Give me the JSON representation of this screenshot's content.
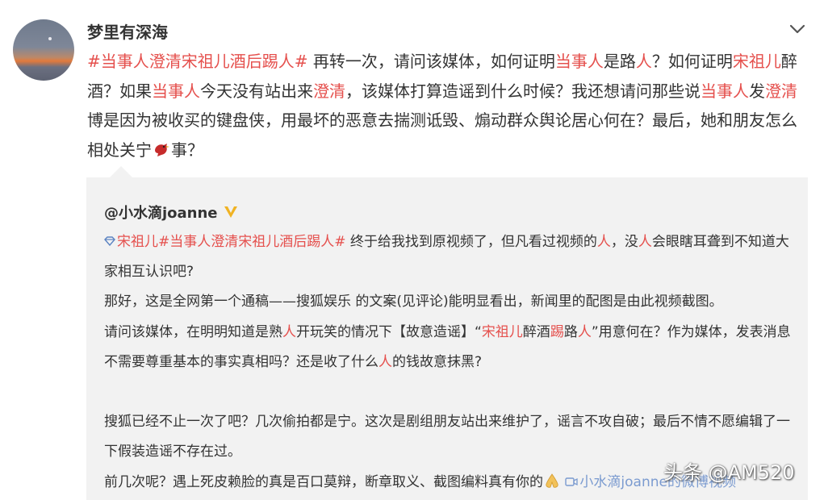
{
  "post": {
    "username": "梦里有深海",
    "segments": [
      {
        "t": "#当事人澄清宋祖儿酒后踢人#",
        "c": "hl"
      },
      {
        "t": " 再转一次，请问该媒体，如何证明",
        "c": ""
      },
      {
        "t": "当事人",
        "c": "hl"
      },
      {
        "t": "是路",
        "c": ""
      },
      {
        "t": "人",
        "c": "hl"
      },
      {
        "t": "？如何证明",
        "c": ""
      },
      {
        "t": "宋祖儿",
        "c": "hl"
      },
      {
        "t": "醉酒？如果",
        "c": ""
      },
      {
        "t": "当事人",
        "c": "hl"
      },
      {
        "t": "今天没有站出来",
        "c": ""
      },
      {
        "t": "澄清",
        "c": "hl"
      },
      {
        "t": "，该媒体打算造谣到什么时候？我还想请问那些说",
        "c": ""
      },
      {
        "t": "当事人",
        "c": "hl"
      },
      {
        "t": "发",
        "c": ""
      },
      {
        "t": "澄清",
        "c": "hl"
      },
      {
        "t": "博是因为被收买的键盘侠，用最坏的恶意去揣测诋毁、煽动群众舆论居心何在？最后，她和朋友怎么相处关宁",
        "c": ""
      }
    ],
    "emoji": "bird-emoji",
    "tail": "事？"
  },
  "repost": {
    "username": "@小水滴joanne",
    "badge": "gold-v-badge",
    "p1": [
      {
        "t": "宋祖儿",
        "c": "hl"
      },
      {
        "t": "#当事人澄清宋祖儿酒后踢人#",
        "c": "hl"
      },
      {
        "t": " 终于给我找到原视频了，但凡看过视频的",
        "c": ""
      },
      {
        "t": "人",
        "c": "hl"
      },
      {
        "t": "，没",
        "c": ""
      },
      {
        "t": "人",
        "c": "hl"
      },
      {
        "t": "会眼瞎耳聋到不知道大家相互认识吧?",
        "c": ""
      }
    ],
    "p2": "那好，这是全网第一个通稿——搜狐娱乐 的文案(见评论)能明显看出，新闻里的配图是由此视频截图。",
    "p3": [
      {
        "t": "请问该媒体，在明明知道是熟",
        "c": ""
      },
      {
        "t": "人",
        "c": "hl"
      },
      {
        "t": "开玩笑的情况下【故意造谣】“",
        "c": ""
      },
      {
        "t": "宋祖儿",
        "c": "hl"
      },
      {
        "t": "醉酒",
        "c": ""
      },
      {
        "t": "踢",
        "c": "hl"
      },
      {
        "t": "路",
        "c": ""
      },
      {
        "t": "人",
        "c": "hl"
      },
      {
        "t": "”用意何在？作为媒体，发表消息不需要尊重基本的事实真相吗？还是收了什么",
        "c": ""
      },
      {
        "t": "人",
        "c": "hl"
      },
      {
        "t": "的钱故意抹黑?",
        "c": ""
      }
    ],
    "p4": "搜狐已经不止一次了吧？几次偷拍都是宁。这次是剧组朋友站出来维护了，谣言不攻自破；最后不情不愿编辑了一下假装造谣不存在过。",
    "p5": "前几次呢？遇上死皮赖脸的真是百口莫辩，断章取义、截图编料真有你的",
    "p5_emoji": "pray-emoji",
    "video_link": "小水滴joanne的微博视频"
  },
  "watermark": "头条 @AM520",
  "colors": {
    "highlight": "#e5504d",
    "link": "#5b83c2",
    "repost_bg": "#f2f2f2"
  }
}
